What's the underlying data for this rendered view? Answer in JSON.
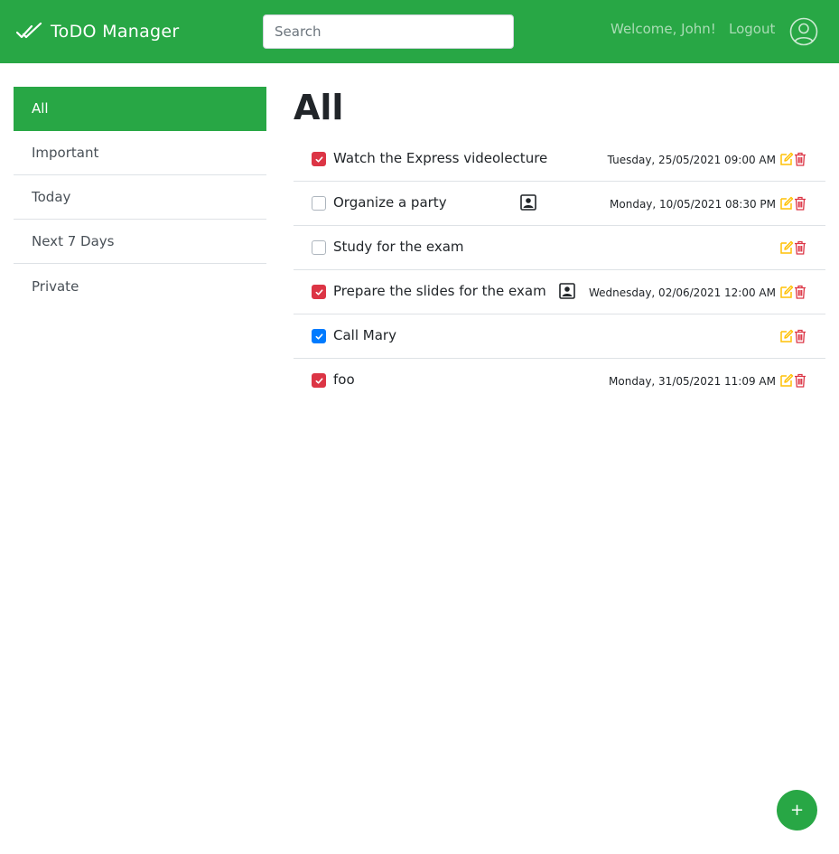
{
  "navbar": {
    "brand": "ToDO Manager",
    "brand_icon": "double-check-icon",
    "search_placeholder": "Search",
    "welcome": "Welcome, John!",
    "logout": "Logout",
    "user_icon": "user-circle-icon",
    "color": "#28a745"
  },
  "sidebar": {
    "items": [
      {
        "label": "All",
        "active": true
      },
      {
        "label": "Important",
        "active": false
      },
      {
        "label": "Today",
        "active": false
      },
      {
        "label": "Next 7 Days",
        "active": false
      },
      {
        "label": "Private",
        "active": false
      }
    ]
  },
  "main": {
    "title": "All",
    "tasks": [
      {
        "description": "Watch the Express videolecture",
        "checked": true,
        "check_color": "#dc3545",
        "private": false,
        "deadline": "Tuesday, 25/05/2021 09:00 AM"
      },
      {
        "description": "Organize a party",
        "checked": false,
        "check_color": null,
        "private": true,
        "deadline": "Monday, 10/05/2021 08:30 PM"
      },
      {
        "description": "Study for the exam",
        "checked": false,
        "check_color": null,
        "private": false,
        "deadline": ""
      },
      {
        "description": "Prepare the slides for the exam",
        "checked": true,
        "check_color": "#dc3545",
        "private": true,
        "deadline": "Wednesday, 02/06/2021 12:00 AM"
      },
      {
        "description": "Call Mary",
        "checked": true,
        "check_color": "#007bff",
        "private": false,
        "deadline": ""
      },
      {
        "description": "foo",
        "checked": true,
        "check_color": "#dc3545",
        "private": false,
        "deadline": "Monday, 31/05/2021 11:09 AM"
      }
    ]
  },
  "fab": {
    "label": "+"
  },
  "colors": {
    "edit": "#ffc107",
    "delete": "#dc3545",
    "important": "#dc3545",
    "normal_check": "#007bff"
  }
}
